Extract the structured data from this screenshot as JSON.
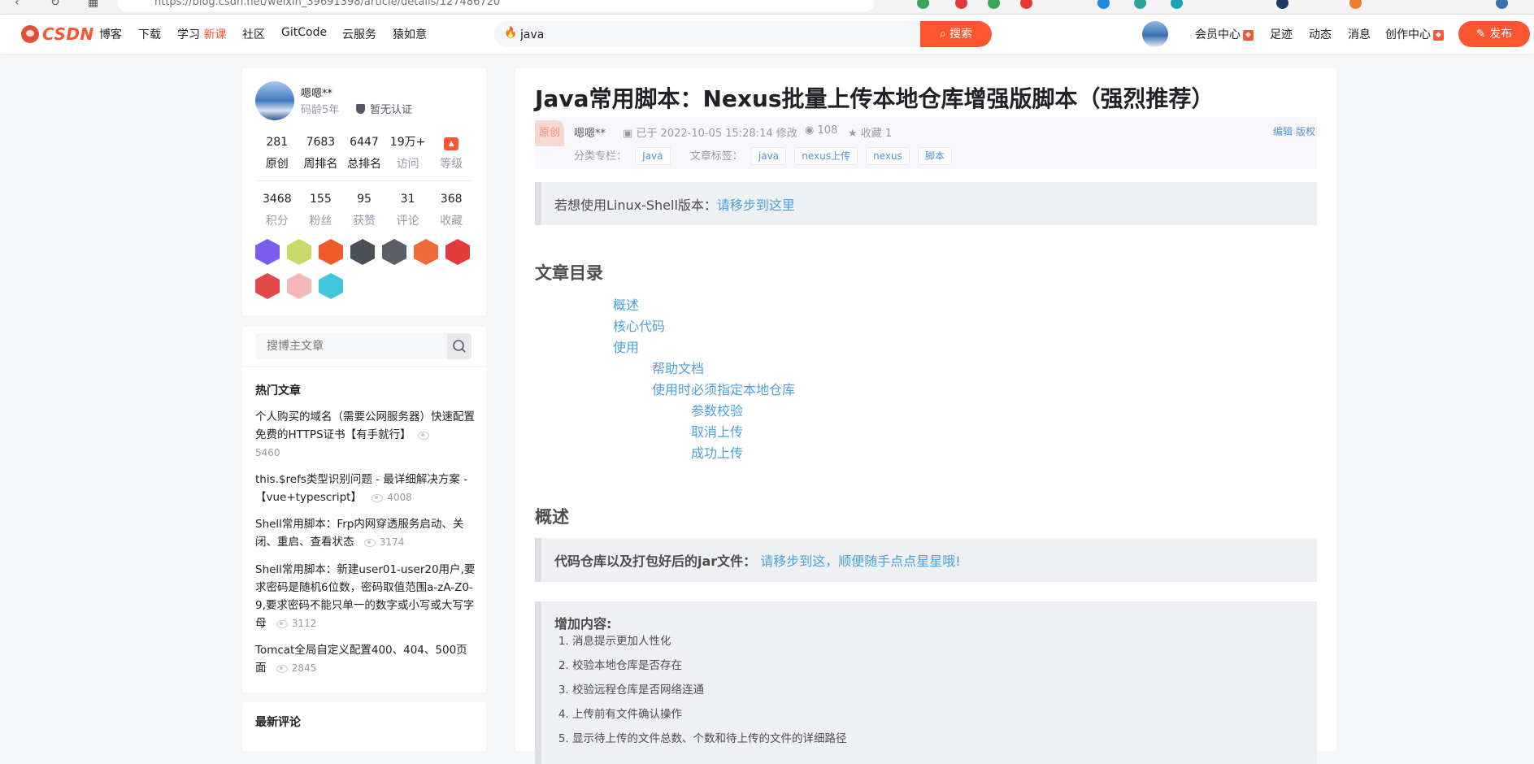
{
  "browser": {
    "url": "https://blog.csdn.net/weixin_39691398/article/details/127486720"
  },
  "toolbar": {
    "logo_text": "CSDN",
    "nav": [
      {
        "label": "博客"
      },
      {
        "label": "下载"
      },
      {
        "label": "学习",
        "badge": "新课"
      },
      {
        "label": "社区"
      },
      {
        "label": "GitCode"
      },
      {
        "label": "云服务"
      },
      {
        "label": "猿如意"
      }
    ],
    "search_value": "java",
    "search_button": "搜索",
    "right_links": [
      "会员中心",
      "足迹",
      "动态",
      "消息",
      "创作中心"
    ],
    "publish_button": "发布"
  },
  "profile": {
    "name": "嗯嗯**",
    "code_age": "码龄5年",
    "certification": "暂无认证",
    "stats_top": [
      {
        "value": "281",
        "label": "原创"
      },
      {
        "value": "7683",
        "label": "周排名"
      },
      {
        "value": "6447",
        "label": "总排名"
      },
      {
        "value": "19万+",
        "label": "访问"
      },
      {
        "value": "",
        "label": "等级"
      }
    ],
    "stats_bottom": [
      {
        "value": "3468",
        "label": "积分"
      },
      {
        "value": "155",
        "label": "粉丝"
      },
      {
        "value": "95",
        "label": "获赞"
      },
      {
        "value": "31",
        "label": "评论"
      },
      {
        "value": "368",
        "label": "收藏"
      }
    ],
    "badge_colors_row1": [
      "#7b5cf0",
      "#c8d86a",
      "#f05a2a",
      "#4b4f57",
      "#5b5e66",
      "#f06a3a",
      "#e23b3b"
    ],
    "badge_colors_row2": [
      "#e24848",
      "#f5b8b8",
      "#3fc7d9"
    ]
  },
  "blog_search": {
    "placeholder": "搜博主文章"
  },
  "hot_articles": {
    "title": "热门文章",
    "items": [
      {
        "title": "个人购买的域名（需要公网服务器）快速配置免费的HTTPS证书【有手就行】",
        "views": "5460"
      },
      {
        "title": "this.$refs类型识别问题 - 最详细解决方案 -【vue+typescript】",
        "views": "4008"
      },
      {
        "title": "Shell常用脚本：Frp内网穿透服务启动、关闭、重启、查看状态",
        "views": "3174"
      },
      {
        "title": "Shell常用脚本：新建user01-user20用户,要求密码是随机6位数，密码取值范围a-zA-Z0-9,要求密码不能只单一的数字或小写或大写字母",
        "views": "3112"
      },
      {
        "title": "Tomcat全局自定义配置400、404、500页面",
        "views": "2845"
      }
    ]
  },
  "latest_comments": {
    "title": "最新评论"
  },
  "article": {
    "title": "Java常用脚本：Nexus批量上传本地仓库增强版脚本（强烈推荐）",
    "original_tag": "原创",
    "author": "嗯嗯**",
    "time": "已于 2022-10-05 15:28:14 修改",
    "views": "108",
    "favorites": "收藏 1",
    "edit": "编辑",
    "copyright": "版权",
    "category_label": "分类专栏：",
    "categories": [
      "Java"
    ],
    "tags_label": "文章标签：",
    "tags": [
      "java",
      "nexus上传",
      "nexus",
      "脚本"
    ],
    "quote1_text": "若想使用Linux-Shell版本：",
    "quote1_link": "请移步到这里",
    "toc_title": "文章目录",
    "toc": [
      {
        "label": "概述",
        "level": 1
      },
      {
        "label": "核心代码",
        "level": 1
      },
      {
        "label": "使用",
        "level": 1
      },
      {
        "label": "帮助文档",
        "level": 2
      },
      {
        "label": "使用时必须指定本地仓库",
        "level": 2
      },
      {
        "label": "参数校验",
        "level": 3
      },
      {
        "label": "取消上传",
        "level": 3
      },
      {
        "label": "成功上传",
        "level": 3
      }
    ],
    "section_overview": "概述",
    "quote2_text": "代码仓库以及打包好后的jar文件：",
    "quote2_link": "请移步到这，顺便随手点点星星哦!",
    "quote3_head": "增加内容:",
    "additions": [
      "消息提示更加人性化",
      "校验本地仓库是否存在",
      "校验远程仓库是否网络连通",
      "上传前有文件确认操作",
      "显示待上传的文件总数、个数和待上传的文件的详细路径"
    ]
  }
}
